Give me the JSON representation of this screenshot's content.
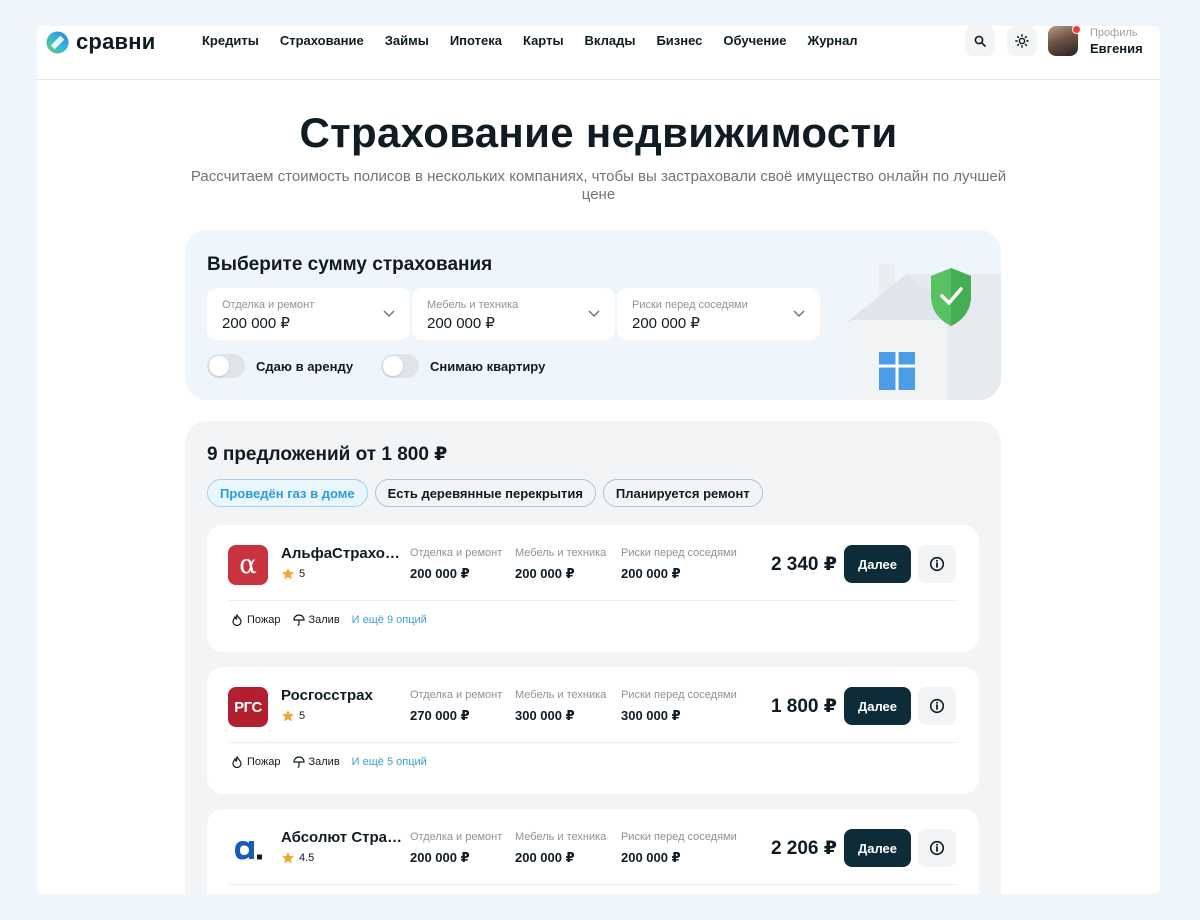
{
  "header": {
    "logo_text": "сравни",
    "nav": [
      "Кредиты",
      "Страхование",
      "Займы",
      "Ипотека",
      "Карты",
      "Вклады",
      "Бизнес",
      "Обучение",
      "Журнал"
    ],
    "profile_caption": "Профиль",
    "profile_name": "Евгения"
  },
  "hero": {
    "title": "Страхование недвижимости",
    "subtitle": "Рассчитаем стоимость полисов в нескольких компаниях, чтобы вы застраховали своё имущество онлайн по лучшей цене"
  },
  "calculator": {
    "title": "Выберите сумму страхования",
    "selects": [
      {
        "label": "Отделка и ремонт",
        "value": "200 000 ₽"
      },
      {
        "label": "Мебель и техника",
        "value": "200 000 ₽"
      },
      {
        "label": "Риски перед соседями",
        "value": "200 000 ₽"
      }
    ],
    "toggles": [
      {
        "label": "Сдаю в аренду",
        "on": false
      },
      {
        "label": "Снимаю квартиру",
        "on": false
      }
    ]
  },
  "offers": {
    "title": "9 предложений от 1 800 ₽",
    "chips": [
      {
        "label": "Проведён газ в доме",
        "active": true
      },
      {
        "label": "Есть деревянные перекрытия",
        "active": false
      },
      {
        "label": "Планируется ремонт",
        "active": false
      }
    ],
    "items": [
      {
        "name": "АльфаСтрахова...",
        "rating": "5",
        "logo": "alfa-logo",
        "logo_color": "#c8333f",
        "columns": [
          {
            "label": "Отделка и ремонт",
            "value": "200 000 ₽"
          },
          {
            "label": "Мебель и техника",
            "value": "200 000 ₽"
          },
          {
            "label": "Риски перед соседями",
            "value": "200 000 ₽"
          }
        ],
        "price": "2 340 ₽",
        "button": "Далее",
        "options": [
          "Пожар",
          "Залив"
        ],
        "more": "И ещё 9 опций"
      },
      {
        "name": "Росгосстрах",
        "rating": "5",
        "logo": "rgs-logo",
        "logo_color": "#b2202f",
        "logo_text": "РГС",
        "columns": [
          {
            "label": "Отделка и ремонт",
            "value": "270 000 ₽"
          },
          {
            "label": "Мебель и техника",
            "value": "300 000 ₽"
          },
          {
            "label": "Риски перед соседями",
            "value": "300 000 ₽"
          }
        ],
        "price": "1 800 ₽",
        "button": "Далее",
        "options": [
          "Пожар",
          "Залив"
        ],
        "more": "И ещё 5 опций"
      },
      {
        "name": "Абсолют Страх...",
        "rating": "4.5",
        "logo": "absolut-logo",
        "logo_color": "#1a5bb8",
        "columns": [
          {
            "label": "Отделка и ремонт",
            "value": "200 000 ₽"
          },
          {
            "label": "Мебель и техника",
            "value": "200 000 ₽"
          },
          {
            "label": "Риски перед соседями",
            "value": "200 000 ₽"
          }
        ],
        "price": "2 206 ₽",
        "button": "Далее",
        "options": [],
        "more": ""
      }
    ]
  },
  "colors": {
    "accent": "#2a9fd6",
    "button_dark": "#0d2b39",
    "star": "#f4a52b",
    "shield": "#58c163"
  }
}
